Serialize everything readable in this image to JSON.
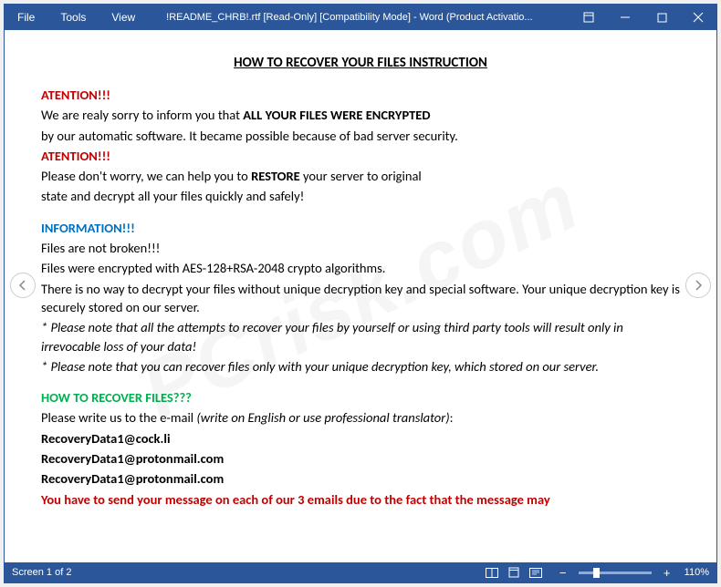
{
  "menu": {
    "file": "File",
    "tools": "Tools",
    "view": "View"
  },
  "title": "!README_CHRB!.rtf [Read-Only] [Compatibility Mode] - Word (Product Activatio...",
  "doc": {
    "heading": "HOW TO RECOVER YOUR FILES INSTRUCTION",
    "attention1": "ATENTION!!!",
    "line1a": "We are realy sorry to inform you that     ",
    "line1b": "ALL YOUR FILES WERE ENCRYPTED",
    "line2": "by our automatic software. It became possible because of bad server security.",
    "attention2": "ATENTION!!!",
    "line3a": "Please don't worry, we can help you to ",
    "line3b": "RESTORE",
    "line3c": " your server to original",
    "line4": "state and decrypt all your files quickly and safely!",
    "info": "INFORMATION!!!",
    "line5": "Files are not broken!!!",
    "line6": "Files were encrypted with AES-128+RSA-2048 crypto algorithms.",
    "line7": "There is no way to decrypt your files without unique decryption key and special software. Your unique decryption key is securely stored on our server.",
    "note1": "* Please note that all the attempts to recover your files by yourself or using third party tools will result only in irrevocable loss of your data!",
    "note2": "* Please note that you can recover files only with your unique decryption key, which stored on our server.",
    "recover": "HOW TO RECOVER FILES???",
    "line8a": "Please write us to the e-mail ",
    "line8b": "(write on English or use professional translator)",
    "line8c": ":",
    "email1": "RecoveryData1@cock.li",
    "email2": "RecoveryData1@protonmail.com",
    "email3": "RecoveryData1@protonmail.com",
    "warning": "You have to send your message on each of our 3 emails due to the fact that the message may"
  },
  "status": {
    "screen": "Screen 1 of 2",
    "zoom": "110%"
  },
  "watermark": "PCrisk.com"
}
